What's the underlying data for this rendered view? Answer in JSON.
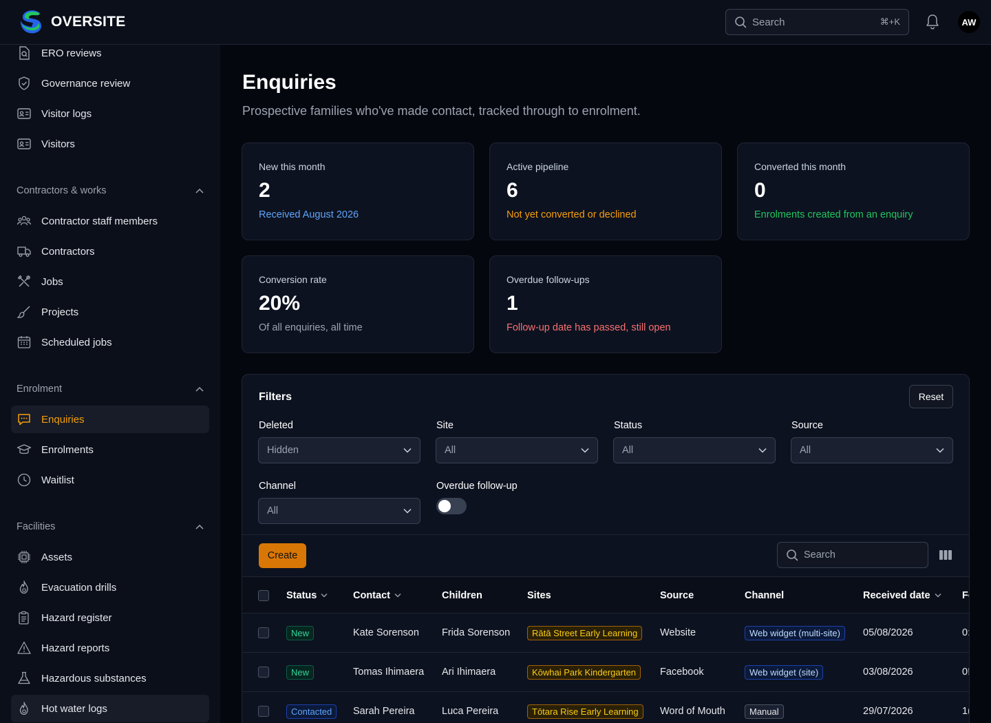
{
  "brand": {
    "name": "OVERSITE",
    "logo_icon": "logo-icon"
  },
  "topbar": {
    "search_placeholder": "Search",
    "search_shortcut": "⌘+K",
    "avatar_initials": "AW"
  },
  "sidebar": {
    "items_top": [
      {
        "label": "ERO reviews",
        "icon": "document-search-icon"
      },
      {
        "label": "Governance review",
        "icon": "shield-check-icon"
      },
      {
        "label": "Visitor logs",
        "icon": "id-card-icon"
      },
      {
        "label": "Visitors",
        "icon": "id-card-icon"
      }
    ],
    "groups": [
      {
        "label": "Contractors & works",
        "items": [
          {
            "label": "Contractor staff members",
            "icon": "users-icon"
          },
          {
            "label": "Contractors",
            "icon": "truck-icon"
          },
          {
            "label": "Jobs",
            "icon": "tools-icon"
          },
          {
            "label": "Projects",
            "icon": "paintbrush-icon"
          },
          {
            "label": "Scheduled jobs",
            "icon": "calendar-icon"
          }
        ]
      },
      {
        "label": "Enrolment",
        "items": [
          {
            "label": "Enquiries",
            "icon": "chat-icon",
            "active": true
          },
          {
            "label": "Enrolments",
            "icon": "graduation-cap-icon"
          },
          {
            "label": "Waitlist",
            "icon": "clock-icon"
          }
        ]
      },
      {
        "label": "Facilities",
        "items": [
          {
            "label": "Assets",
            "icon": "chip-icon"
          },
          {
            "label": "Evacuation drills",
            "icon": "fire-icon"
          },
          {
            "label": "Hazard register",
            "icon": "clipboard-icon"
          },
          {
            "label": "Hazard reports",
            "icon": "warning-icon"
          },
          {
            "label": "Hazardous substances",
            "icon": "flask-icon"
          },
          {
            "label": "Hot water logs",
            "icon": "fire-icon"
          }
        ]
      }
    ]
  },
  "page": {
    "title": "Enquiries",
    "subtitle": "Prospective families who've made contact, tracked through to enrolment."
  },
  "stats": [
    {
      "label": "New this month",
      "value": "2",
      "note": "Received August 2026",
      "color": "#60a5fa"
    },
    {
      "label": "Active pipeline",
      "value": "6",
      "note": "Not yet converted or declined",
      "color": "#f59e0b"
    },
    {
      "label": "Converted this month",
      "value": "0",
      "note": "Enrolments created from an enquiry",
      "color": "#22c55e"
    },
    {
      "label": "Conversion rate",
      "value": "20%",
      "note": "Of all enquiries, all time",
      "color": "#9ca3af"
    },
    {
      "label": "Overdue follow-ups",
      "value": "1",
      "note": "Follow-up date has passed, still open",
      "color": "#f87171"
    }
  ],
  "filters": {
    "title": "Filters",
    "reset_label": "Reset",
    "deleted": {
      "label": "Deleted",
      "value": "Hidden"
    },
    "site": {
      "label": "Site",
      "value": "All"
    },
    "status": {
      "label": "Status",
      "value": "All"
    },
    "source": {
      "label": "Source",
      "value": "All"
    },
    "channel": {
      "label": "Channel",
      "value": "All"
    },
    "overdue": {
      "label": "Overdue follow-up",
      "on": false
    }
  },
  "toolbar": {
    "create_label": "Create",
    "search_placeholder": "Search"
  },
  "table": {
    "headers": {
      "status": "Status",
      "contact": "Contact",
      "children": "Children",
      "sites": "Sites",
      "source": "Source",
      "channel": "Channel",
      "received": "Received date",
      "followup": "Fo"
    },
    "rows": [
      {
        "status": "New",
        "status_kind": "new",
        "contact": "Kate Sorenson",
        "children": "Frida Sorenson",
        "site": "Rātā Street Early Learning",
        "source": "Website",
        "channel": "Web widget (multi-site)",
        "channel_kind": "web",
        "received": "05/08/2026",
        "followup": "0:"
      },
      {
        "status": "New",
        "status_kind": "new",
        "contact": "Tomas Ihimaera",
        "children": "Ari Ihimaera",
        "site": "Kōwhai Park Kindergarten",
        "source": "Facebook",
        "channel": "Web widget (site)",
        "channel_kind": "web",
        "received": "03/08/2026",
        "followup": "0!"
      },
      {
        "status": "Contacted",
        "status_kind": "contacted",
        "contact": "Sarah Pereira",
        "children": "Luca Pereira",
        "site": "Tōtara Rise Early Learning",
        "source": "Word of Mouth",
        "channel": "Manual",
        "channel_kind": "manual",
        "received": "29/07/2026",
        "followup": "1("
      }
    ]
  }
}
